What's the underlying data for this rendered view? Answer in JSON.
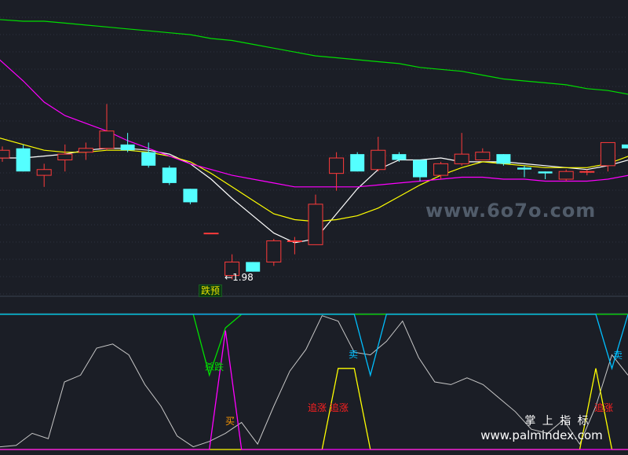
{
  "chart_data": [
    {
      "type": "candlestick",
      "title": "",
      "xlabel": "",
      "ylabel": "",
      "grid": true,
      "candles": [
        {
          "open": 2.59,
          "close": 2.63,
          "high": 2.65,
          "low": 2.57
        },
        {
          "open": 2.64,
          "close": 2.52,
          "high": 2.66,
          "low": 2.52
        },
        {
          "open": 2.5,
          "close": 2.53,
          "high": 2.56,
          "low": 2.44
        },
        {
          "open": 2.58,
          "close": 2.61,
          "high": 2.66,
          "low": 2.52
        },
        {
          "open": 2.62,
          "close": 2.64,
          "high": 2.67,
          "low": 2.58
        },
        {
          "open": 2.64,
          "close": 2.73,
          "high": 2.87,
          "low": 2.63
        },
        {
          "open": 2.66,
          "close": 2.63,
          "high": 2.72,
          "low": 2.62
        },
        {
          "open": 2.62,
          "close": 2.55,
          "high": 2.67,
          "low": 2.54
        },
        {
          "open": 2.54,
          "close": 2.46,
          "high": 2.55,
          "low": 2.45
        },
        {
          "open": 2.43,
          "close": 2.36,
          "high": 2.43,
          "low": 2.35
        },
        {
          "open": 2.2,
          "close": 2.2,
          "high": 2.2,
          "low": 2.2
        },
        {
          "open": 1.98,
          "close": 2.05,
          "high": 2.09,
          "low": 1.96
        },
        {
          "open": 2.05,
          "close": 2.0,
          "high": 2.05,
          "low": 2.0
        },
        {
          "open": 2.05,
          "close": 2.16,
          "high": 2.17,
          "low": 2.03
        },
        {
          "open": 2.16,
          "close": 2.16,
          "high": 2.18,
          "low": 2.09
        },
        {
          "open": 2.14,
          "close": 2.35,
          "high": 2.4,
          "low": 2.14
        },
        {
          "open": 2.51,
          "close": 2.59,
          "high": 2.62,
          "low": 2.42
        },
        {
          "open": 2.61,
          "close": 2.52,
          "high": 2.62,
          "low": 2.52
        },
        {
          "open": 2.53,
          "close": 2.63,
          "high": 2.7,
          "low": 2.52
        },
        {
          "open": 2.61,
          "close": 2.58,
          "high": 2.62,
          "low": 2.57
        },
        {
          "open": 2.58,
          "close": 2.49,
          "high": 2.58,
          "low": 2.47
        },
        {
          "open": 2.5,
          "close": 2.56,
          "high": 2.57,
          "low": 2.48
        },
        {
          "open": 2.56,
          "close": 2.61,
          "high": 2.72,
          "low": 2.55
        },
        {
          "open": 2.58,
          "close": 2.62,
          "high": 2.64,
          "low": 2.58
        },
        {
          "open": 2.61,
          "close": 2.56,
          "high": 2.61,
          "low": 2.55
        },
        {
          "open": 2.54,
          "close": 2.53,
          "high": 2.55,
          "low": 2.49
        },
        {
          "open": 2.52,
          "close": 2.51,
          "high": 2.52,
          "low": 2.48
        },
        {
          "open": 2.48,
          "close": 2.52,
          "high": 2.53,
          "low": 2.47
        },
        {
          "open": 2.52,
          "close": 2.52,
          "high": 2.53,
          "low": 2.5
        },
        {
          "open": 2.55,
          "close": 2.67,
          "high": 2.67,
          "low": 2.52
        },
        {
          "open": 2.66,
          "close": 2.64,
          "high": 2.78,
          "low": 2.57
        }
      ],
      "ma_lines": [
        {
          "color": "#ffffff",
          "values": [
            2.59,
            2.59,
            2.6,
            2.61,
            2.63,
            2.64,
            2.64,
            2.63,
            2.61,
            2.56,
            2.48,
            2.38,
            2.29,
            2.2,
            2.15,
            2.17,
            2.3,
            2.43,
            2.53,
            2.58,
            2.58,
            2.59,
            2.57,
            2.57,
            2.57,
            2.56,
            2.55,
            2.54,
            2.53,
            2.55,
            2.58
          ]
        },
        {
          "color": "#ffff00",
          "values": [
            2.7,
            2.66,
            2.63,
            2.62,
            2.62,
            2.63,
            2.63,
            2.62,
            2.6,
            2.57,
            2.51,
            2.44,
            2.37,
            2.3,
            2.27,
            2.26,
            2.27,
            2.29,
            2.33,
            2.39,
            2.45,
            2.5,
            2.54,
            2.57,
            2.56,
            2.55,
            2.54,
            2.54,
            2.54,
            2.56,
            2.6
          ]
        },
        {
          "color": "#ff00ff",
          "values": [
            3.12,
            2.99,
            2.88,
            2.81,
            2.77,
            2.73,
            2.68,
            2.64,
            2.6,
            2.56,
            2.53,
            2.5,
            2.48,
            2.46,
            2.44,
            2.44,
            2.44,
            2.44,
            2.45,
            2.46,
            2.47,
            2.48,
            2.49,
            2.49,
            2.48,
            2.48,
            2.47,
            2.47,
            2.47,
            2.48,
            2.5
          ]
        },
        {
          "color": "#00dd00",
          "values": [
            3.31,
            3.3,
            3.3,
            3.29,
            3.28,
            3.27,
            3.26,
            3.25,
            3.24,
            3.23,
            3.21,
            3.2,
            3.18,
            3.16,
            3.14,
            3.12,
            3.11,
            3.1,
            3.09,
            3.08,
            3.06,
            3.05,
            3.04,
            3.02,
            3.0,
            2.99,
            2.98,
            2.97,
            2.95,
            2.94,
            2.92
          ]
        }
      ],
      "ylim": [
        1.86,
        3.41
      ],
      "annotations": {
        "low_value": "1.98",
        "low_arrow": "←",
        "warning_label": "跌预"
      },
      "watermark": "www.6o7o.com"
    },
    {
      "type": "line",
      "title": "",
      "ylim": [
        0,
        100
      ],
      "x": [
        0,
        1,
        2,
        3,
        4,
        5,
        6,
        7,
        8,
        9,
        10,
        11,
        12,
        13,
        14,
        15,
        16,
        17,
        18,
        19,
        20,
        21,
        22,
        23,
        24,
        25,
        26,
        27,
        28,
        29,
        30,
        31,
        32,
        33,
        34,
        35,
        36,
        37,
        38,
        39,
        40,
        41,
        42,
        43,
        44,
        45,
        46,
        47,
        48,
        49,
        50
      ],
      "series": [
        {
          "color": "#c8c8c8",
          "values": [
            2,
            3,
            12,
            8,
            50,
            55,
            75,
            78,
            70,
            48,
            32,
            10,
            2,
            6,
            12,
            20,
            4,
            32,
            58,
            74,
            99,
            95,
            72,
            70,
            80,
            95,
            68,
            50,
            48,
            53,
            48,
            38,
            28,
            15,
            12,
            22,
            4,
            32,
            70,
            55
          ]
        },
        {
          "color": "#00e000",
          "values": [
            100,
            100,
            100,
            100,
            100,
            100,
            100,
            100,
            100,
            100,
            100,
            100,
            100,
            55,
            90,
            100,
            100,
            100,
            100,
            100,
            100,
            100,
            100,
            100,
            100,
            100,
            100,
            100,
            100,
            100,
            100,
            100,
            100,
            100,
            100,
            100,
            100,
            100,
            100,
            100
          ]
        },
        {
          "color": "#00bfff",
          "values": [
            100,
            100,
            100,
            100,
            100,
            100,
            100,
            100,
            100,
            100,
            100,
            100,
            100,
            100,
            100,
            100,
            100,
            100,
            100,
            100,
            100,
            100,
            100,
            55,
            100,
            100,
            100,
            100,
            100,
            100,
            100,
            100,
            100,
            100,
            100,
            100,
            100,
            100,
            60,
            100
          ]
        },
        {
          "color": "#ffff00",
          "values": [
            0,
            0,
            0,
            0,
            0,
            0,
            0,
            0,
            0,
            0,
            0,
            0,
            0,
            0,
            0,
            0,
            0,
            0,
            0,
            0,
            0,
            60,
            60,
            0,
            0,
            0,
            0,
            0,
            0,
            0,
            0,
            0,
            0,
            0,
            0,
            0,
            0,
            60,
            0,
            0
          ]
        },
        {
          "color": "#ff00ff",
          "values": [
            0,
            0,
            0,
            0,
            0,
            0,
            0,
            0,
            0,
            0,
            0,
            0,
            0,
            0,
            88,
            0,
            0,
            0,
            0,
            0,
            0,
            0,
            0,
            0,
            0,
            0,
            0,
            0,
            0,
            0,
            0,
            0,
            0,
            0,
            0,
            0,
            0,
            0,
            0,
            0
          ]
        }
      ],
      "annotations": [
        {
          "text": "杀跌",
          "color": "#00e000"
        },
        {
          "text": "卖",
          "color": "#00bfff"
        },
        {
          "text": "卖",
          "color": "#00bfff"
        },
        {
          "text": "买",
          "color": "#ff9900"
        },
        {
          "text": "追涨 追涨",
          "color": "#ff2020"
        },
        {
          "text": "追涨",
          "color": "#ff2020"
        }
      ],
      "watermark": {
        "line1": "掌 上 指 标",
        "line2": "www.palmindex.com"
      }
    }
  ]
}
